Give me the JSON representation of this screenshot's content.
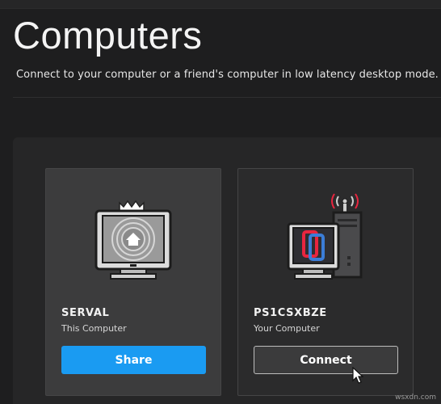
{
  "header": {
    "title": "Computers",
    "subtitle": "Connect to your computer or a friend's computer in low latency desktop mode."
  },
  "cards": [
    {
      "name": "SERVAL",
      "description": "This Computer",
      "button_label": "Share",
      "illustration": "home-computer-icon",
      "button_color": "#1a9bf2"
    },
    {
      "name": "PS1CSXBZE",
      "description": "Your Computer",
      "button_label": "Connect",
      "illustration": "remote-computer-icon",
      "button_color": "#3b3b3c"
    }
  ],
  "watermark": "wsxdn.com",
  "colors": {
    "background": "#1e1e1f",
    "panel": "#262627",
    "accent": "#1a9bf2",
    "parsec_red": "#e8253f"
  }
}
